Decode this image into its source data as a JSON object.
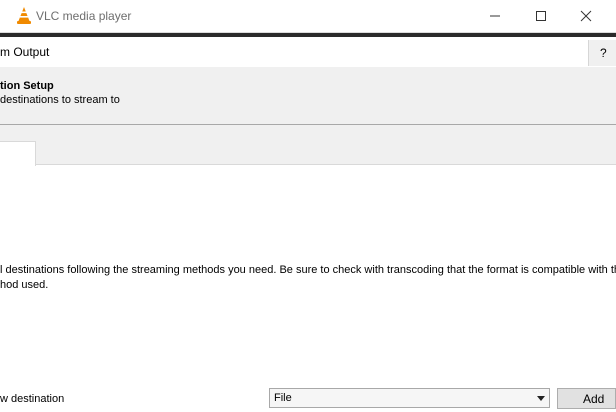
{
  "window": {
    "title": "VLC media player"
  },
  "dialog": {
    "title": "m Output",
    "help_label": "?",
    "header_title": "tion Setup",
    "header_subtitle": " destinations to stream to",
    "instructions_line1": "l destinations following the streaming methods you need. Be sure to check with transcoding that the format is compatible with the",
    "instructions_line2": "hod used.",
    "new_destination_label": "w destination",
    "destination_select_value": "File",
    "add_button_label": "Add"
  },
  "icons": [
    "vlc-cone-icon",
    "minimize-icon",
    "maximize-icon",
    "close-icon",
    "chevron-down-icon"
  ],
  "colors": {
    "vlc_orange": "#f08a00",
    "header_bg": "#f0f0f0"
  }
}
